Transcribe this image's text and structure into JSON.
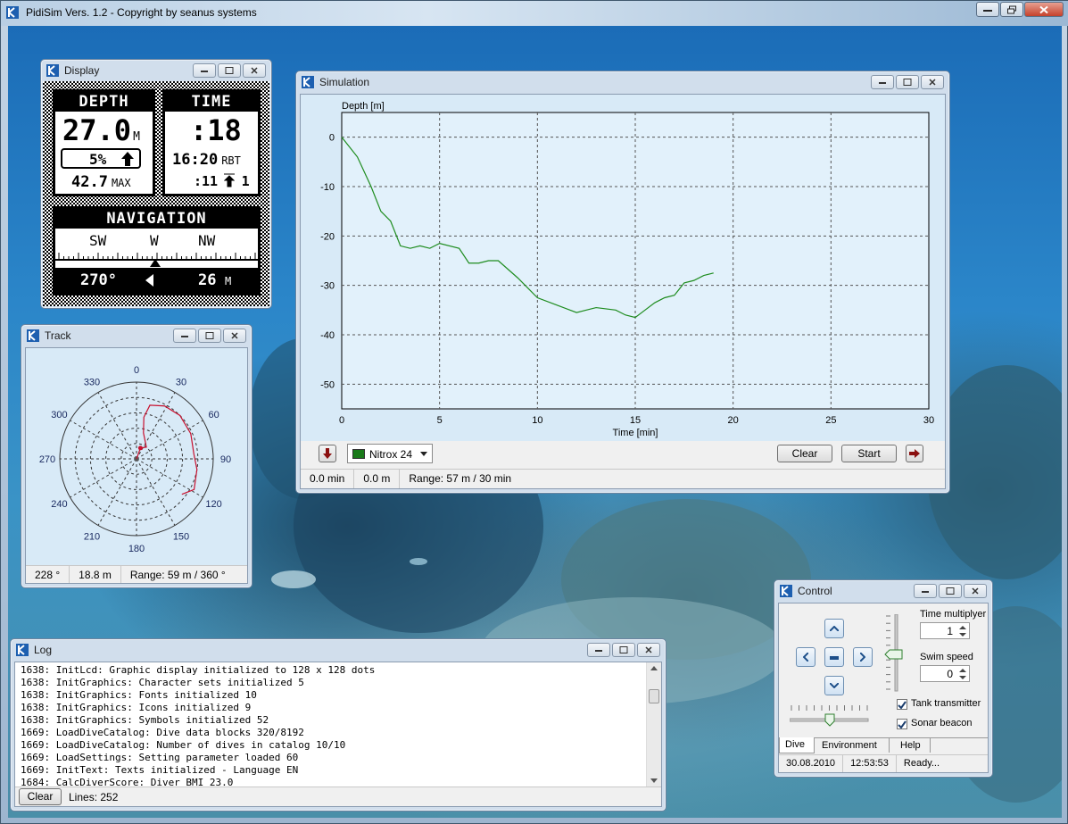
{
  "app": {
    "title": "PidiSim Vers. 1.2 - Copyright by seanus systems"
  },
  "display_window": {
    "title": "Display",
    "depth": {
      "header": "DEPTH",
      "value": "27.0",
      "unit": "M",
      "percent": "5%",
      "max_value": "42.7",
      "max_label": "MAX"
    },
    "time": {
      "header": "TIME",
      "value": ":18",
      "rbt_value": "16:20",
      "rbt_label": "RBT",
      "stop_time": ":11",
      "stop_count": "1"
    },
    "navigation": {
      "header": "NAVIGATION",
      "dirs": [
        "SW",
        "W",
        "NW"
      ],
      "heading": "270°",
      "distance": "26",
      "distance_unit": "M"
    }
  },
  "track_window": {
    "title": "Track",
    "angle_labels": [
      "0",
      "30",
      "60",
      "90",
      "120",
      "150",
      "180",
      "210",
      "240",
      "270",
      "300",
      "330"
    ],
    "track_color": "#c8102e",
    "track_points": [
      {
        "bearing": 0,
        "dist": 0
      },
      {
        "bearing": 20,
        "dist": 0.15
      },
      {
        "bearing": 40,
        "dist": 0.2
      },
      {
        "bearing": 15,
        "dist": 0.35
      },
      {
        "bearing": 10,
        "dist": 0.55
      },
      {
        "bearing": 14,
        "dist": 0.72
      },
      {
        "bearing": 28,
        "dist": 0.78
      },
      {
        "bearing": 45,
        "dist": 0.8
      },
      {
        "bearing": 65,
        "dist": 0.78
      },
      {
        "bearing": 85,
        "dist": 0.75
      },
      {
        "bearing": 100,
        "dist": 0.8
      },
      {
        "bearing": 118,
        "dist": 0.85
      },
      {
        "bearing": 128,
        "dist": 0.75
      }
    ],
    "status": {
      "bearing": "228 °",
      "distance": "18.8 m",
      "range": "Range: 59 m / 360 °"
    }
  },
  "simulation_window": {
    "title": "Simulation",
    "gas_mix": "Nitrox 24",
    "gas_color": "#1a7a1a",
    "clear_label": "Clear",
    "start_label": "Start",
    "status": {
      "time": "0.0 min",
      "depth": "0.0 m",
      "range": "Range: 57 m / 30 min"
    }
  },
  "chart_data": {
    "type": "line",
    "title": "",
    "xlabel": "Time [min]",
    "ylabel": "Depth [m]",
    "xlim": [
      0,
      30
    ],
    "ylim": [
      -55,
      5
    ],
    "xticks": [
      0,
      5,
      10,
      15,
      20,
      25,
      30
    ],
    "yticks": [
      0,
      -10,
      -20,
      -30,
      -40,
      -50
    ],
    "grid": true,
    "series": [
      {
        "color": "#1e8c1e",
        "x": [
          0,
          0.8,
          1.5,
          2,
          2.5,
          3,
          3.5,
          4,
          4.5,
          5,
          6,
          6.5,
          7,
          7.5,
          8,
          9,
          9.5,
          10,
          11,
          12,
          12.5,
          13,
          14,
          14.5,
          15,
          15.5,
          16,
          16.5,
          17,
          17.5,
          18,
          18.5,
          19
        ],
        "y": [
          0,
          -4,
          -10,
          -15,
          -17,
          -22,
          -22.5,
          -22,
          -22.5,
          -21.5,
          -22.5,
          -25.5,
          -25.5,
          -25,
          -25,
          -28.5,
          -30.5,
          -32.5,
          -34,
          -35.5,
          -35,
          -34.5,
          -35,
          -36,
          -36.5,
          -35,
          -33.5,
          -32.5,
          -32,
          -29.5,
          -29,
          -28,
          -27.5
        ]
      }
    ]
  },
  "control_window": {
    "title": "Control",
    "time_multiplyer_label": "Time multiplyer",
    "time_multiplyer_value": "1",
    "swim_speed_label": "Swim speed",
    "swim_speed_value": "0",
    "tank_transmitter_label": "Tank transmitter",
    "sonar_beacon_label": "Sonar beacon",
    "tank_transmitter_checked": true,
    "sonar_beacon_checked": true,
    "tabs": [
      "Dive",
      "Environment",
      "Help"
    ],
    "status": {
      "date": "30.08.2010",
      "time": "12:53:53",
      "state": "Ready..."
    }
  },
  "log_window": {
    "title": "Log",
    "lines": [
      "1638: InitLcd: Graphic display initialized to 128 x 128 dots",
      "1638: InitGraphics: Character sets initialized 5",
      "1638: InitGraphics: Fonts initialized 10",
      "1638: InitGraphics: Icons initialized 9",
      "1638: InitGraphics: Symbols initialized 52",
      "1669: LoadDiveCatalog: Dive data blocks 320/8192",
      "1669: LoadDiveCatalog: Number of dives in catalog 10/10",
      "1669: LoadSettings: Setting parameter loaded 60",
      "1669: InitText: Texts initialized - Language EN",
      "1684: CalcDiverScore: Diver BMI 23.0"
    ],
    "clear_label": "Clear",
    "lines_count": "Lines: 252"
  }
}
